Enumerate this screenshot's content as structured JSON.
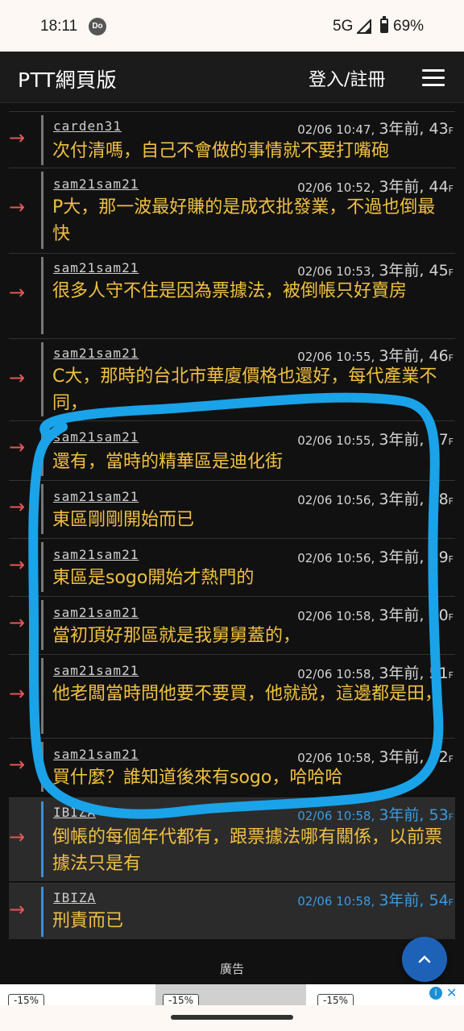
{
  "status_bar": {
    "time": "18:11",
    "app_badge": "Do",
    "network": "5G",
    "battery": "69%"
  },
  "header": {
    "title": "PTT網頁版",
    "login_label": "登入/註冊",
    "menu_icon": "hamburger-menu-icon"
  },
  "comments": [
    {
      "tag": "→",
      "user": "carden31",
      "date": "02/06 10:47,",
      "ago": "3年前",
      "floor": ", 43",
      "floor_suffix": "F",
      "text": "次付清嗎，自己不會做的事情就不要打嘴砲"
    },
    {
      "tag": "→",
      "user": "sam21sam21",
      "date": "02/06 10:52,",
      "ago": "3年前",
      "floor": ", 44",
      "floor_suffix": "F",
      "text": "P大，那一波最好賺的是成衣批發業，不過也倒最快"
    },
    {
      "tag": "→",
      "user": "sam21sam21",
      "date": "02/06 10:53,",
      "ago": "3年前",
      "floor": ", 45",
      "floor_suffix": "F",
      "text": "很多人守不住是因為票據法，被倒帳只好賣房"
    },
    {
      "tag": "→",
      "user": "sam21sam21",
      "date": "02/06 10:55,",
      "ago": "3年前",
      "floor": ", 46",
      "floor_suffix": "F",
      "text": "C大，那時的台北市華廈價格也還好，每代產業不同，"
    },
    {
      "tag": "→",
      "user": "sam21sam21",
      "date": "02/06 10:55,",
      "ago": "3年前",
      "floor": ", 47",
      "floor_suffix": "F",
      "text": "還有，當時的精華區是迪化街"
    },
    {
      "tag": "→",
      "user": "sam21sam21",
      "date": "02/06 10:56,",
      "ago": "3年前",
      "floor": ", 48",
      "floor_suffix": "F",
      "text": "東區剛剛開始而已"
    },
    {
      "tag": "→",
      "user": "sam21sam21",
      "date": "02/06 10:56,",
      "ago": "3年前",
      "floor": ", 49",
      "floor_suffix": "F",
      "text": "東區是sogo開始才熱門的"
    },
    {
      "tag": "→",
      "user": "sam21sam21",
      "date": "02/06 10:58,",
      "ago": "3年前",
      "floor": ", 50",
      "floor_suffix": "F",
      "text": "當初頂好那區就是我舅舅蓋的，"
    },
    {
      "tag": "→",
      "user": "sam21sam21",
      "date": "02/06 10:58,",
      "ago": "3年前",
      "floor": ", 51",
      "floor_suffix": "F",
      "text": "他老闆當時問他要不要買，他就說，這邊都是田，"
    },
    {
      "tag": "→",
      "user": "sam21sam21",
      "date": "02/06 10:58,",
      "ago": "3年前",
      "floor": ", 52",
      "floor_suffix": "F",
      "text": "買什麼？誰知道後來有sogo，哈哈哈"
    },
    {
      "tag": "→",
      "user": "IBIZA",
      "date": "02/06 10:58,",
      "ago": "3年前",
      "floor": ", 53",
      "floor_suffix": "F",
      "text": "倒帳的每個年代都有，跟票據法哪有關係，以前票據法只是有"
    },
    {
      "tag": "→",
      "user": "IBIZA",
      "date": "02/06 10:58,",
      "ago": "3年前",
      "floor": ", 54",
      "floor_suffix": "F",
      "text": "刑責而已"
    }
  ],
  "ad": {
    "label": "廣告",
    "discount_1": "-15%",
    "discount_2": "-15%",
    "discount_3": "-15%",
    "info_icon": "info-icon",
    "close_icon": "close-icon"
  },
  "fab_icon": "scroll-to-top-icon",
  "colors": {
    "push_text": "#f0c040",
    "arrow": "#e55757",
    "author_highlight": "#3a9be0",
    "annotation_stroke": "#1aa3e8"
  }
}
